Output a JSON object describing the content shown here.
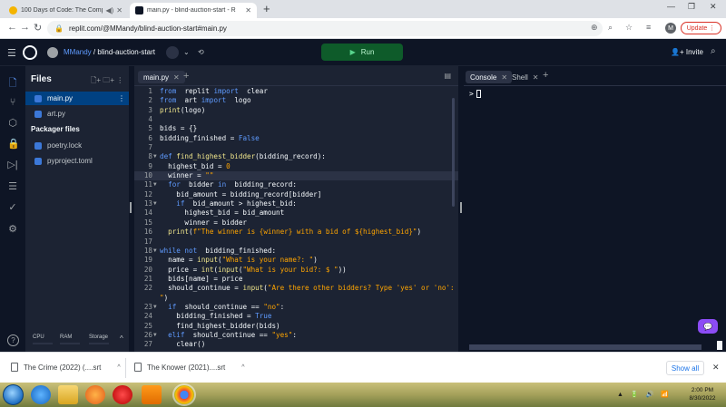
{
  "browser": {
    "tabs": [
      {
        "title": "100 Days of Code: The Comp",
        "active": false
      },
      {
        "title": "main.py - blind-auction-start - R",
        "active": true
      }
    ],
    "new_tab": "+",
    "url": "replit.com/@MMandy/blind-auction-start#main.py",
    "profile_initial": "M",
    "update_label": "Update",
    "win_min": "—",
    "win_max": "❐",
    "win_close": "✕"
  },
  "header": {
    "username": "MMandy",
    "separator": "/",
    "repl_name": "blind-auction-start",
    "run_label": "Run",
    "invite_label": "Invite"
  },
  "files": {
    "title": "Files",
    "items": [
      {
        "name": "main.py",
        "selected": true
      },
      {
        "name": "art.py",
        "selected": false
      }
    ],
    "packager_title": "Packager files",
    "packager_items": [
      {
        "name": "poetry.lock"
      },
      {
        "name": "pyproject.toml"
      }
    ],
    "resources": {
      "cpu": "CPU",
      "ram": "RAM",
      "storage": "Storage"
    },
    "help": "?"
  },
  "editor": {
    "tab_label": "main.py",
    "current_line": 10,
    "lines": [
      {
        "n": "1",
        "fold": "",
        "code": [
          [
            "kw",
            "from"
          ],
          [
            "",
            "  replit "
          ],
          [
            "kw",
            "import"
          ],
          [
            "",
            "  clear"
          ]
        ]
      },
      {
        "n": "2",
        "fold": "",
        "code": [
          [
            "kw",
            "from"
          ],
          [
            "",
            "  art "
          ],
          [
            "kw",
            "import"
          ],
          [
            "",
            "  logo"
          ]
        ]
      },
      {
        "n": "3",
        "fold": "",
        "code": [
          [
            "fn",
            "print"
          ],
          [
            "",
            "(logo)"
          ]
        ]
      },
      {
        "n": "4",
        "fold": "",
        "code": []
      },
      {
        "n": "5",
        "fold": "",
        "code": [
          [
            "",
            "bids = {}"
          ]
        ]
      },
      {
        "n": "6",
        "fold": "",
        "code": [
          [
            "",
            "bidding_finished = "
          ],
          [
            "kw",
            "False"
          ]
        ]
      },
      {
        "n": "7",
        "fold": "",
        "code": []
      },
      {
        "n": "8",
        "fold": "▼",
        "code": [
          [
            "kw",
            "def"
          ],
          [
            "fn",
            " find_highest_bidder"
          ],
          [
            "",
            "(bidding_record):"
          ]
        ]
      },
      {
        "n": "9",
        "fold": "",
        "code": [
          [
            "",
            "  highest_bid = "
          ],
          [
            "str",
            "0"
          ]
        ]
      },
      {
        "n": "10",
        "fold": "",
        "code": [
          [
            "",
            "  winner = "
          ],
          [
            "str",
            "\"\""
          ]
        ]
      },
      {
        "n": "11",
        "fold": "▼",
        "code": [
          [
            "kw",
            "  for"
          ],
          [
            "",
            "  bidder "
          ],
          [
            "kw",
            "in"
          ],
          [
            "",
            "  bidding_record:"
          ]
        ]
      },
      {
        "n": "12",
        "fold": "",
        "code": [
          [
            "",
            "    bid_amount = bidding_record[bidder]"
          ]
        ]
      },
      {
        "n": "13",
        "fold": "▼",
        "code": [
          [
            "kw",
            "    if"
          ],
          [
            "",
            "  bid_amount > highest_bid:"
          ]
        ]
      },
      {
        "n": "14",
        "fold": "",
        "code": [
          [
            "",
            "      highest_bid = bid_amount"
          ]
        ]
      },
      {
        "n": "15",
        "fold": "",
        "code": [
          [
            "",
            "      winner = bidder"
          ]
        ]
      },
      {
        "n": "16",
        "fold": "",
        "code": [
          [
            "fn",
            "  print"
          ],
          [
            "",
            "("
          ],
          [
            "str",
            "f\"The winner is {winner} with a bid of ${highest_bid}\""
          ],
          [
            "",
            ")"
          ]
        ]
      },
      {
        "n": "17",
        "fold": "",
        "code": []
      },
      {
        "n": "18",
        "fold": "▼",
        "code": [
          [
            "kw",
            "while not"
          ],
          [
            "",
            "  bidding_finished:"
          ]
        ]
      },
      {
        "n": "19",
        "fold": "",
        "code": [
          [
            "",
            "  name = "
          ],
          [
            "fn",
            "input"
          ],
          [
            "",
            "("
          ],
          [
            "str",
            "\"What is your name?: \""
          ],
          [
            "",
            ")"
          ]
        ]
      },
      {
        "n": "20",
        "fold": "",
        "code": [
          [
            "",
            "  price = "
          ],
          [
            "fn",
            "int"
          ],
          [
            "",
            "("
          ],
          [
            "fn",
            "input"
          ],
          [
            "",
            "("
          ],
          [
            "str",
            "\"What is your bid?: $ \""
          ],
          [
            "",
            "))"
          ]
        ]
      },
      {
        "n": "21",
        "fold": "",
        "code": [
          [
            "",
            "  bids[name] = price"
          ]
        ]
      },
      {
        "n": "22",
        "fold": "",
        "code": [
          [
            "",
            "  should_continue = "
          ],
          [
            "fn",
            "input"
          ],
          [
            "",
            "("
          ],
          [
            "str",
            "\"Are there other bidders? Type 'yes' or 'no':"
          ]
        ]
      },
      {
        "n": "",
        "fold": "",
        "code": [
          [
            "str",
            "\""
          ],
          [
            "",
            ")"
          ]
        ]
      },
      {
        "n": "23",
        "fold": "▼",
        "code": [
          [
            "kw",
            "  if"
          ],
          [
            "",
            "  should_continue == "
          ],
          [
            "str",
            "\"no\""
          ],
          [
            "",
            ":"
          ]
        ]
      },
      {
        "n": "24",
        "fold": "",
        "code": [
          [
            "",
            "    bidding_finished = "
          ],
          [
            "kw",
            "True"
          ]
        ]
      },
      {
        "n": "25",
        "fold": "",
        "code": [
          [
            "",
            "    find_highest_bidder(bids)"
          ]
        ]
      },
      {
        "n": "26",
        "fold": "▼",
        "code": [
          [
            "kw",
            "  elif"
          ],
          [
            "",
            "  should_continue == "
          ],
          [
            "str",
            "\"yes\""
          ],
          [
            "",
            ":"
          ]
        ]
      },
      {
        "n": "27",
        "fold": "",
        "code": [
          [
            "",
            "    clear()"
          ]
        ]
      }
    ]
  },
  "console": {
    "tabs": [
      {
        "label": "Console",
        "active": true
      },
      {
        "label": "Shell",
        "active": false
      }
    ],
    "prompt": ">"
  },
  "downloads": {
    "items": [
      {
        "name": "The Crime (2022) (....srt"
      },
      {
        "name": "The Knower (2021)....srt"
      }
    ],
    "show_all": "Show all"
  },
  "taskbar": {
    "time": "2:00 PM",
    "date": "8/30/2022"
  },
  "colors": {
    "replit_bg": "#0e1525",
    "panel_bg": "#1c2333",
    "run_green": "#0e5b2a",
    "accent_blue": "#5f9bff",
    "keyword": "#5f9bff",
    "string": "#ffa500",
    "chat_purple": "#8c4cf5"
  },
  "icons": {
    "rail": [
      "files-icon",
      "git-icon",
      "packages-icon",
      "secrets-icon",
      "debugger-icon",
      "database-icon",
      "check-icon",
      "settings-icon"
    ]
  }
}
